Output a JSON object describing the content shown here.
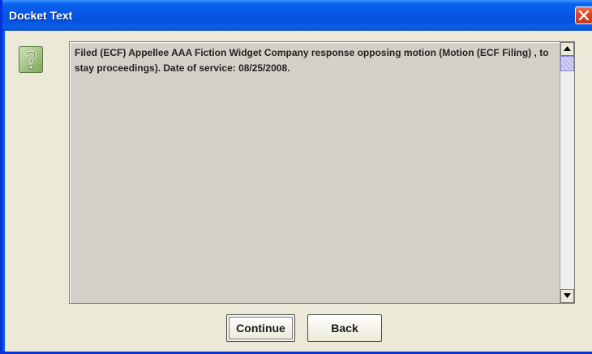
{
  "window": {
    "title": "Docket Text"
  },
  "dialog": {
    "icon": "question-icon",
    "docket_text": "Filed (ECF) Appellee AAA Fiction Widget Company response opposing motion (Motion (ECF Filing) , to stay proceedings). Date of service: 08/25/2008."
  },
  "buttons": {
    "continue_label": "Continue",
    "back_label": "Back"
  },
  "colors": {
    "titlebar": "#0758e6",
    "close_button": "#d64526",
    "dialog_background": "#ece9d8",
    "text_area_background": "#d4d0c8"
  }
}
